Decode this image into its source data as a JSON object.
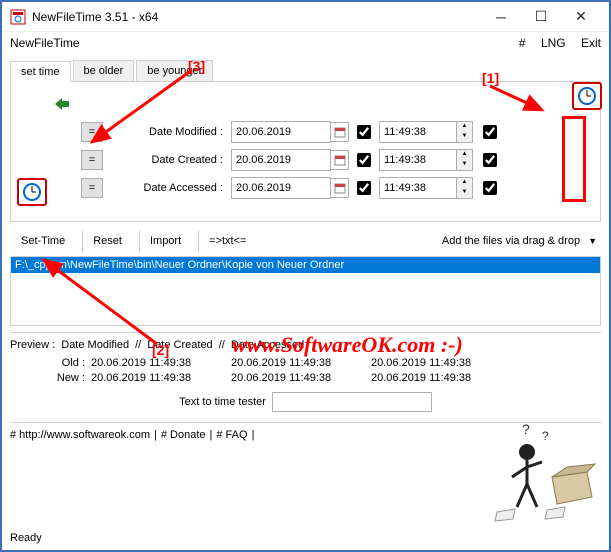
{
  "window": {
    "title": "NewFileTime 3.51 - x64",
    "menu_app": "NewFileTime",
    "menu_hash": "#",
    "menu_lng": "LNG",
    "menu_exit": "Exit"
  },
  "tabs": {
    "set_time": "set time",
    "be_older": "be older",
    "be_younger": "be younger"
  },
  "rows": {
    "eq": "=",
    "modified_label": "Date Modified :",
    "created_label": "Date Created :",
    "accessed_label": "Date Accessed :",
    "date": "20.06.2019",
    "time": "11:49:38"
  },
  "toolbar": {
    "set_time": "Set-Time",
    "reset": "Reset",
    "import": "Import",
    "txt": "=>txt<=",
    "drag": "Add the files via drag & drop"
  },
  "file_list": {
    "selected": "F:\\_cpp_m\\NewFileTime\\bin\\Neuer Ordner\\Kopie von Neuer Ordner"
  },
  "preview": {
    "header_preview": "Preview :",
    "header_modified": "Date Modified",
    "header_created": "Date Created",
    "header_accessed": "Date Accessed",
    "sep": "//",
    "old_label": "Old :",
    "new_label": "New :",
    "old_modified": "20.06.2019 11:49:38",
    "old_created": "20.06.2019 11:49:38",
    "old_accessed": "20.06.2019 11:49:38",
    "new_modified": "20.06.2019 11:49:38",
    "new_created": "20.06.2019 11:49:38",
    "new_accessed": "20.06.2019 11:49:38"
  },
  "tester": {
    "label": "Text to time tester",
    "value": ""
  },
  "footer": {
    "link_site": "# http://www.softwareok.com",
    "link_donate": "# Donate",
    "link_faq": "# FAQ",
    "sep": "|"
  },
  "status": "Ready",
  "annotations": {
    "a1": "[1]",
    "a2": "[2]",
    "a3": "[3]"
  },
  "watermark": "www.SoftwareOK.com :-)"
}
